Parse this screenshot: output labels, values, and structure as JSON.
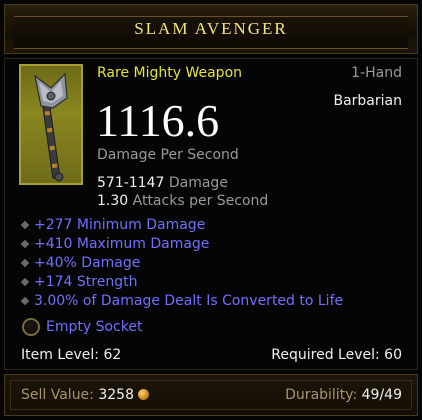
{
  "item": {
    "name": "SLAM AVENGER",
    "rarity_type": "Rare Mighty Weapon",
    "hand": "1-Hand",
    "class": "Barbarian",
    "dps": "1116.6",
    "dps_label": "Damage Per Second",
    "damage_range": "571-1147",
    "damage_label": "Damage",
    "attacks_per_second": "1.30",
    "aps_label": "Attacks per Second",
    "icon": "axe-icon"
  },
  "affixes": [
    "+277 Minimum Damage",
    "+410 Maximum Damage",
    "+40% Damage",
    "+174 Strength",
    "3.00% of Damage Dealt Is Converted to Life"
  ],
  "socket": {
    "label": "Empty Socket",
    "icon": "socket-icon"
  },
  "levels": {
    "item_level": "Item Level: 62",
    "required_level": "Required Level: 60"
  },
  "footer": {
    "sell_label": "Sell Value:",
    "sell_value": "3258",
    "gold_icon": "gold-coin-icon",
    "durability_label": "Durability:",
    "durability_value": "49/49"
  },
  "colors": {
    "title": "#f3e77a",
    "rare": "#e6e63a",
    "affix": "#7070ff",
    "label_gray": "#9a9a9a",
    "footer_label": "#a89468"
  }
}
